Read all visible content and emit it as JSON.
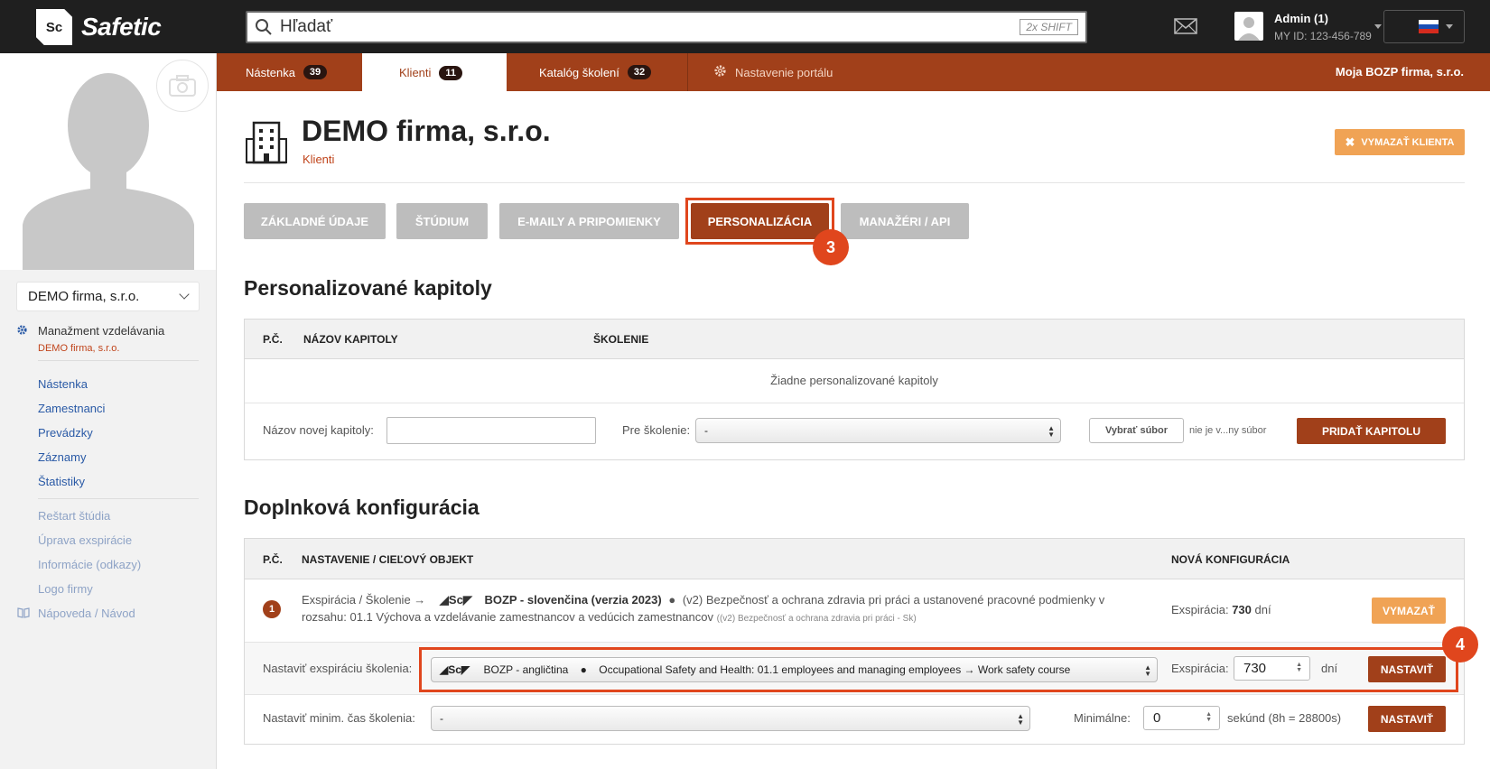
{
  "topbar": {
    "logo_mark": "Sc",
    "logo_text": "Safetic",
    "search_placeholder": "Hľadať",
    "search_hint": "2x SHIFT",
    "user_name": "Admin (1)",
    "user_id": "MY ID: 123-456-789"
  },
  "sidebar": {
    "company": "DEMO firma, s.r.o.",
    "mgmt_title": "Manažment vzdelávania",
    "mgmt_sub": "DEMO firma, s.r.o.",
    "links": [
      "Nástenka",
      "Zamestnanci",
      "Prevádzky",
      "Záznamy",
      "Štatistiky"
    ],
    "links2": [
      "Reštart štúdia",
      "Úprava exspirácie",
      "Informácie (odkazy)",
      "Logo firmy",
      "Nápoveda / Návod"
    ]
  },
  "tabs": [
    {
      "label": "Nástenka",
      "count": "39"
    },
    {
      "label": "Klienti",
      "count": "11"
    },
    {
      "label": "Katalóg školení",
      "count": "32"
    },
    {
      "label": "Nastavenie portálu"
    }
  ],
  "portal_name": "Moja BOZP firma, s.r.o.",
  "header": {
    "title": "DEMO firma, s.r.o.",
    "breadcrumb": "Klienti",
    "delete_button": "VYMAZAŤ KLIENTA"
  },
  "subtabs": [
    "ZÁKLADNÉ ÚDAJE",
    "ŠTÚDIUM",
    "E-MAILY A PRIPOMIENKY",
    "PERSONALIZÁCIA",
    "MANAŽÉRI / API"
  ],
  "steps": [
    "3",
    "4"
  ],
  "chapters": {
    "title": "Personalizované kapitoly",
    "col_no": "P.Č.",
    "col_name": "NÁZOV KAPITOLY",
    "col_training": "ŠKOLENIE",
    "empty": "Žiadne personalizované kapitoly",
    "new_label": "Názov novej kapitoly:",
    "new_value": "",
    "for_training_label": "Pre školenie:",
    "for_training_value": "-",
    "file_button": "Vybrať súbor",
    "file_status": "nie je v...ny súbor",
    "add_button": "PRIDAŤ KAPITOLU"
  },
  "config": {
    "title": "Doplnková konfigurácia",
    "col_no": "P.Č.",
    "col_setting": "NASTAVENIE / CIEĽOVÝ OBJEKT",
    "col_new": "NOVÁ KONFIGURÁCIA",
    "row": {
      "num": "1",
      "prefix": "Exspirácia / Školenie →",
      "logo": "Sc",
      "course": "BOZP - slovenčina (verzia 2023)",
      "bullet": "●",
      "desc": "(v2) Bezpečnosť a ochrana zdravia pri práci a ustanovené pracovné podmienky v rozsahu: 01.1 Výchova a vzdelávanie zamestnancov a vedúcich zamestnancov",
      "small": "((v2) Bezpečnosť a ochrana zdravia pri práci - Sk)",
      "expiry_label": "Exspirácia:",
      "expiry_value": "730",
      "expiry_unit": "dní",
      "delete_button": "VYMAZAŤ"
    },
    "set_expiry": {
      "label": "Nastaviť exspiráciu školenia:",
      "select_logo": "Sc",
      "select_course": "BOZP - angličtina",
      "select_bullet": "●",
      "select_rest": "Occupational Safety and Health: 01.1 employees and managing employees → Work safety course",
      "expiry_label": "Exspirácia:",
      "expiry_value": "730",
      "unit": "dní",
      "button": "NASTAVIŤ"
    },
    "set_min": {
      "label": "Nastaviť minim. čas školenia:",
      "select_value": "-",
      "min_label": "Minimálne:",
      "min_value": "0",
      "unit": "sekúnd (8h = 28800s)",
      "button": "NASTAVIŤ"
    }
  },
  "colors": {
    "brand": "#a1401a",
    "highlight": "#e0461d",
    "orange": "#f0a355",
    "topbar": "#1f1f1f"
  }
}
